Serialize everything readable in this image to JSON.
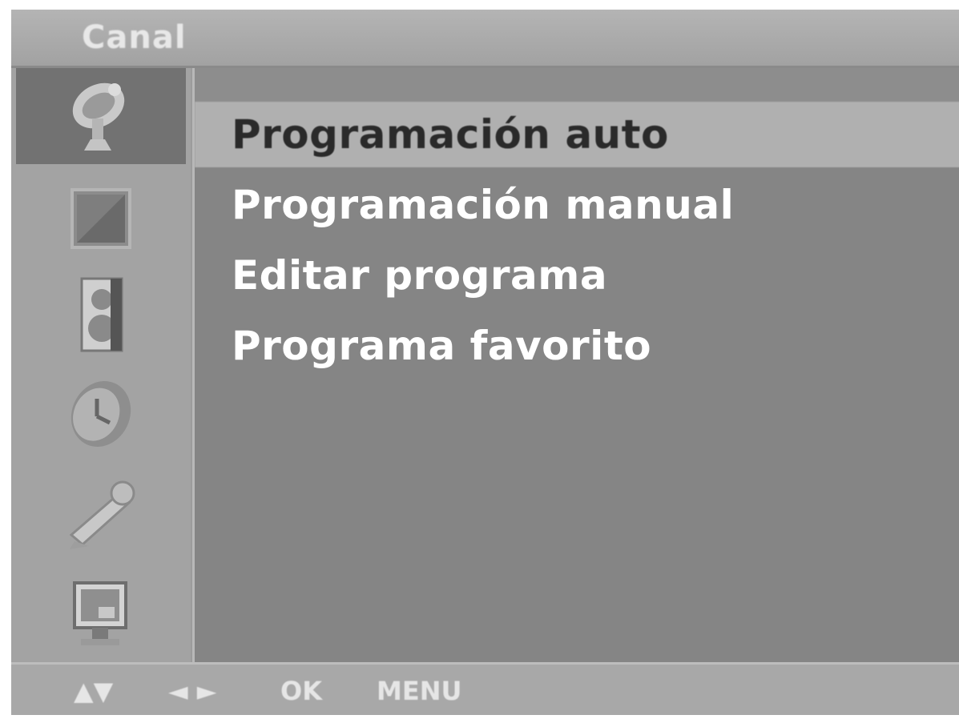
{
  "header": {
    "title": "Canal"
  },
  "sidebar": {
    "items": [
      {
        "icon": "satellite-dish-icon",
        "active": true
      },
      {
        "icon": "picture-icon",
        "active": false
      },
      {
        "icon": "speaker-icon",
        "active": false
      },
      {
        "icon": "clock-icon",
        "active": false
      },
      {
        "icon": "wrench-icon",
        "active": false
      },
      {
        "icon": "pc-monitor-icon",
        "active": false
      }
    ]
  },
  "menu": {
    "items": [
      {
        "label": "Programación auto",
        "selected": true
      },
      {
        "label": "Programación manual",
        "selected": false
      },
      {
        "label": "Editar programa",
        "selected": false
      },
      {
        "label": "Programa favorito",
        "selected": false
      }
    ]
  },
  "footer": {
    "updown_label": "▲▼",
    "leftright_label": "◄ ►",
    "ok_label": "OK",
    "menu_label": "MENU"
  }
}
